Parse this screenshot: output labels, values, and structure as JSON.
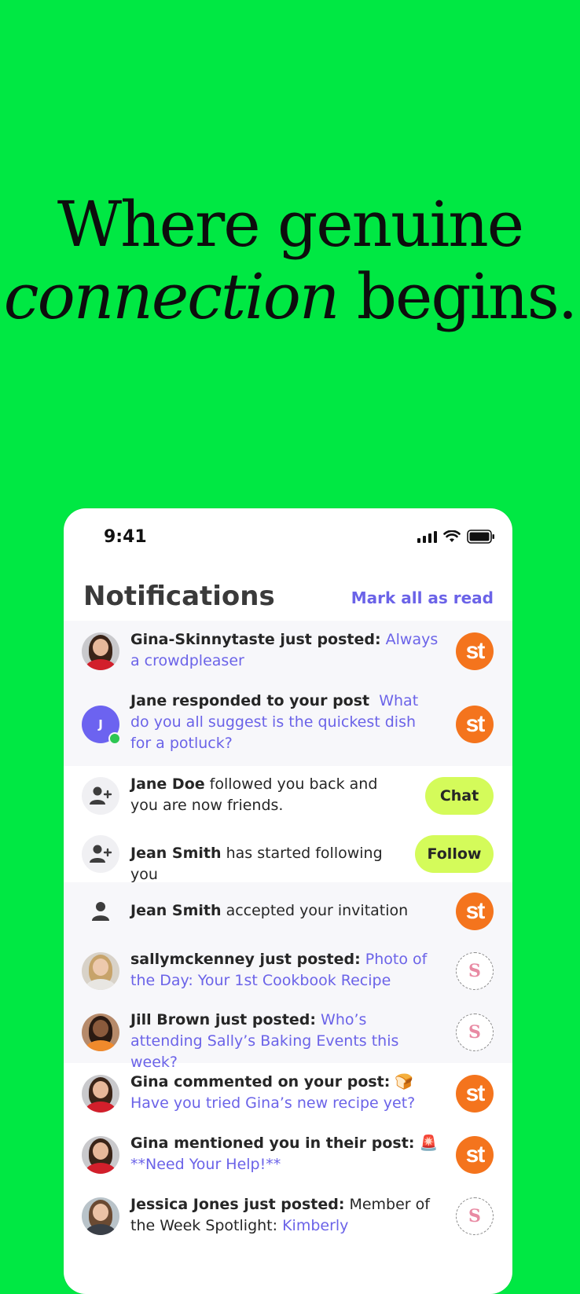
{
  "headline": {
    "line1": "Where genuine",
    "line2_italic": "connection",
    "line2_rest": " begins."
  },
  "status_bar": {
    "time": "9:41"
  },
  "header": {
    "title": "Notifications",
    "mark_all": "Mark all as read"
  },
  "notifications": [
    {
      "bold": "Gina-Skinnytaste just posted:",
      "plain": "",
      "link": "Always a crowdplea­ser",
      "badge": "st",
      "unread": true
    },
    {
      "bold": "Jane responded to your post",
      "plain": "",
      "link": "What do you all suggest is the quickest dish for a potluck?",
      "badge": "st",
      "unread": true
    },
    {
      "bold": "Jane Doe",
      "plain": " followed you back and you are now friends.",
      "link": "",
      "button": "Chat",
      "unread": false
    },
    {
      "bold": "Jean Smith",
      "plain": " has started following you",
      "link": "",
      "button": "Follow",
      "unread": false
    },
    {
      "bold": "Jean Smith",
      "plain": " accepted your invitation",
      "link": "",
      "badge": "st",
      "unread": true
    },
    {
      "bold": "sallymckenney just posted:",
      "plain": "",
      "link": "Photo of the Day: Your 1st Cookbook Recipe",
      "badge": "sally",
      "unread": true
    },
    {
      "bold": "Jill Brown just posted:",
      "plain": "",
      "link": "Who’s attending Sally’s Baking Events this week?",
      "badge": "sally",
      "unread": true
    },
    {
      "bold": "Gina commented on your post:",
      "emoji": "🍞",
      "link": "Have you tried Gina’s new recipe yet?",
      "badge": "st",
      "unread": false
    },
    {
      "bold": "Gina mentioned you in their post:",
      "emoji": "🚨",
      "link": "**Need Your Help!**",
      "badge": "st",
      "unread": false
    },
    {
      "bold": "Jessica Jones just posted:",
      "plain": " Member of the Week Spotlight:",
      "link": "Kimberly",
      "badge": "sally",
      "unread": false
    }
  ],
  "avatar_letter": "J",
  "badge_text": "st",
  "sally_badge_letter": "S",
  "colors": {
    "background": "#00e843",
    "accent": "#6b63e8",
    "badge_orange": "#f4741d",
    "pill": "#d4fb5a",
    "online": "#2dc653"
  }
}
